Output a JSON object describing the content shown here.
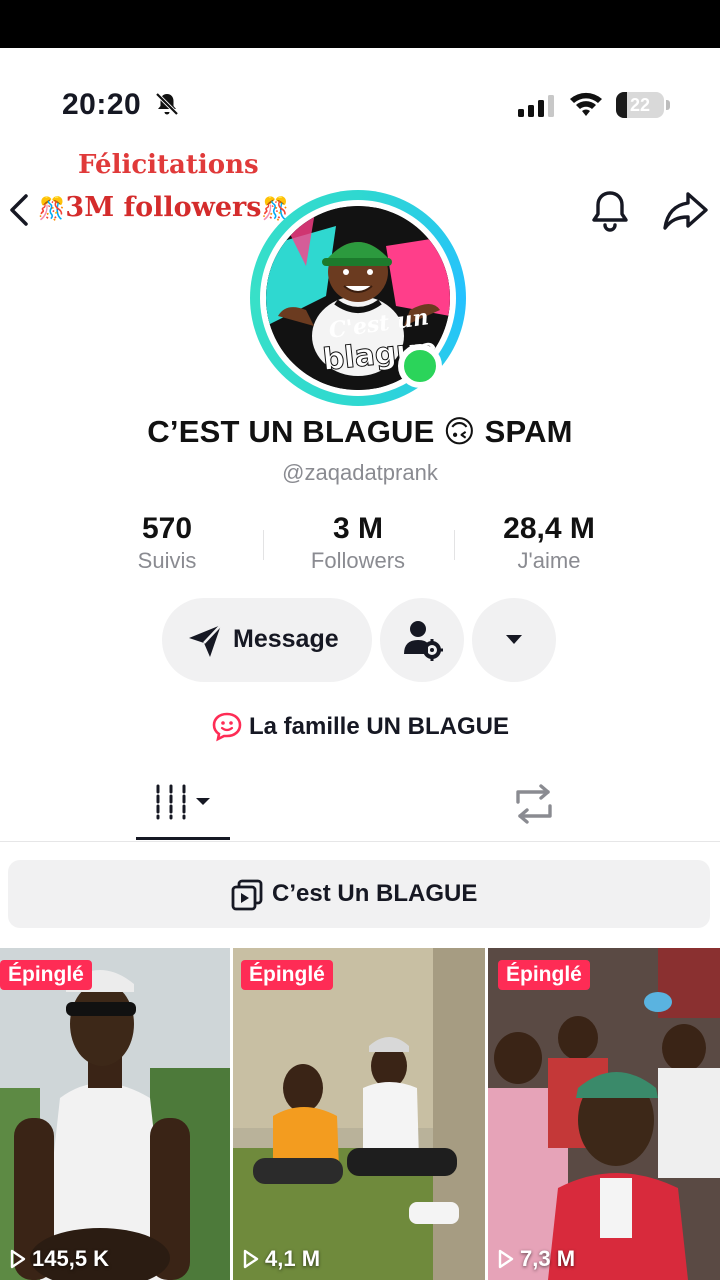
{
  "status_bar": {
    "time": "20:20",
    "battery": "22",
    "battery_level": 0.22,
    "icons": [
      "bell-off-icon",
      "signal-icon",
      "wifi-icon",
      "battery-icon"
    ]
  },
  "overlay": {
    "line1": "Félicitations",
    "line2": "3M followers",
    "emoji": "🎊"
  },
  "header": {
    "icons": [
      "chevron-left-icon",
      "bell-icon",
      "share-icon"
    ]
  },
  "profile": {
    "display_name": "C’EST UN BLAGUE 🙃 SPAM",
    "username": "@zaqadatprank",
    "avatar_text_1": "C'est un",
    "avatar_text_2": "blague",
    "stats": [
      {
        "value": "570",
        "label": "Suivis"
      },
      {
        "value": "3 M",
        "label": "Followers"
      },
      {
        "value": "28,4 M",
        "label": "J'aime"
      }
    ],
    "message_label": "Message",
    "bio": "La famille UN BLAGUE"
  },
  "playlist": {
    "label": "C’est Un BLAGUE"
  },
  "videos": [
    {
      "badge": "Épinglé",
      "views": "145,5 K"
    },
    {
      "badge": "Épinglé",
      "views": "4,1 M"
    },
    {
      "badge": "Épinglé",
      "views": "7,3 M"
    }
  ],
  "colors": {
    "accent_red": "#fe2c55",
    "ring": "#2fd8d0",
    "online": "#2bd45a",
    "congrats": "#d42c2c"
  }
}
